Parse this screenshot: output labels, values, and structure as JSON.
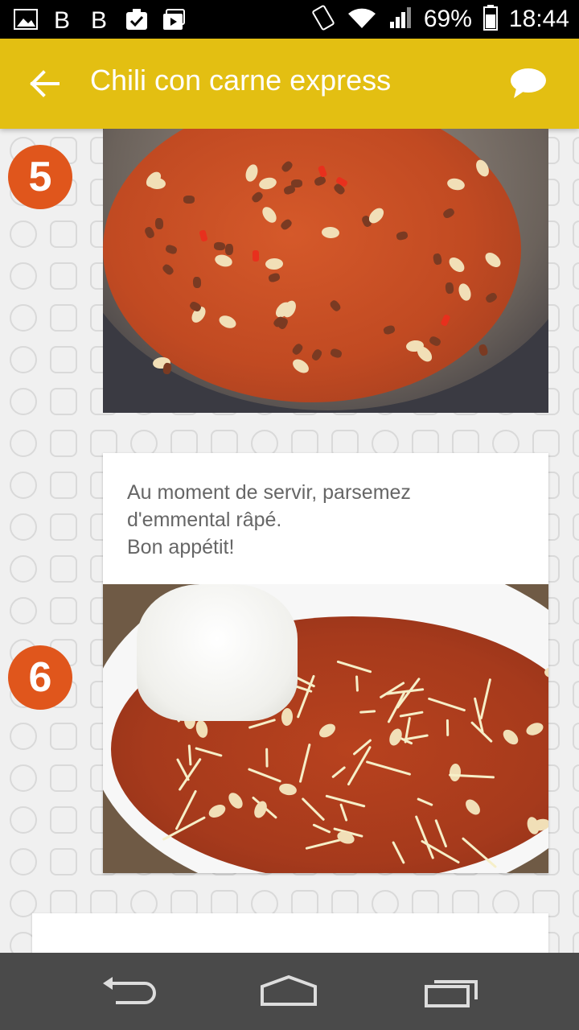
{
  "status_bar": {
    "battery": "69%",
    "time": "18:44"
  },
  "app_bar": {
    "title": "Chili con carne express"
  },
  "steps": [
    {
      "number": "5"
    },
    {
      "number": "6",
      "text": "Au moment de servir, parsemez\nd'emmental râpé.\nBon appétit!"
    }
  ]
}
